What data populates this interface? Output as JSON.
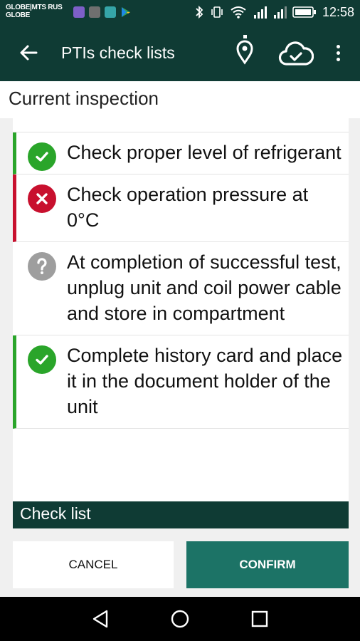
{
  "status_bar": {
    "carrier_line1": "GLOBE|MTS RUS",
    "carrier_line2": "GLOBE",
    "time": "12:58",
    "notification_icons": [
      "viber-icon",
      "gallery-icon",
      "shield-app-icon",
      "play-store-icon"
    ],
    "notification_colors": [
      "#7d5fc8",
      "#6f6f6f",
      "#35a5a8",
      "#37a350"
    ]
  },
  "app_bar": {
    "title": "PTIs check lists"
  },
  "section": {
    "title": "Current inspection"
  },
  "items": [
    {
      "status": "passed",
      "text": "Check proper level of refrigerant"
    },
    {
      "status": "failed",
      "text": "Check operation pressure at 0°C"
    },
    {
      "status": "unknown",
      "text": "At completion of successful test, unplug unit and coil power cable and store in compartment"
    },
    {
      "status": "passed",
      "text": "Complete history card and place it in the document holder of the unit"
    }
  ],
  "checklist_bar": {
    "label": "Check list"
  },
  "buttons": {
    "cancel": "CANCEL",
    "confirm": "CONFIRM"
  },
  "colors": {
    "primary_dark": "#0f3b34",
    "confirm": "#1c7366",
    "passed": "#2aa52a",
    "failed": "#c8102e",
    "unknown": "#9e9e9e"
  }
}
